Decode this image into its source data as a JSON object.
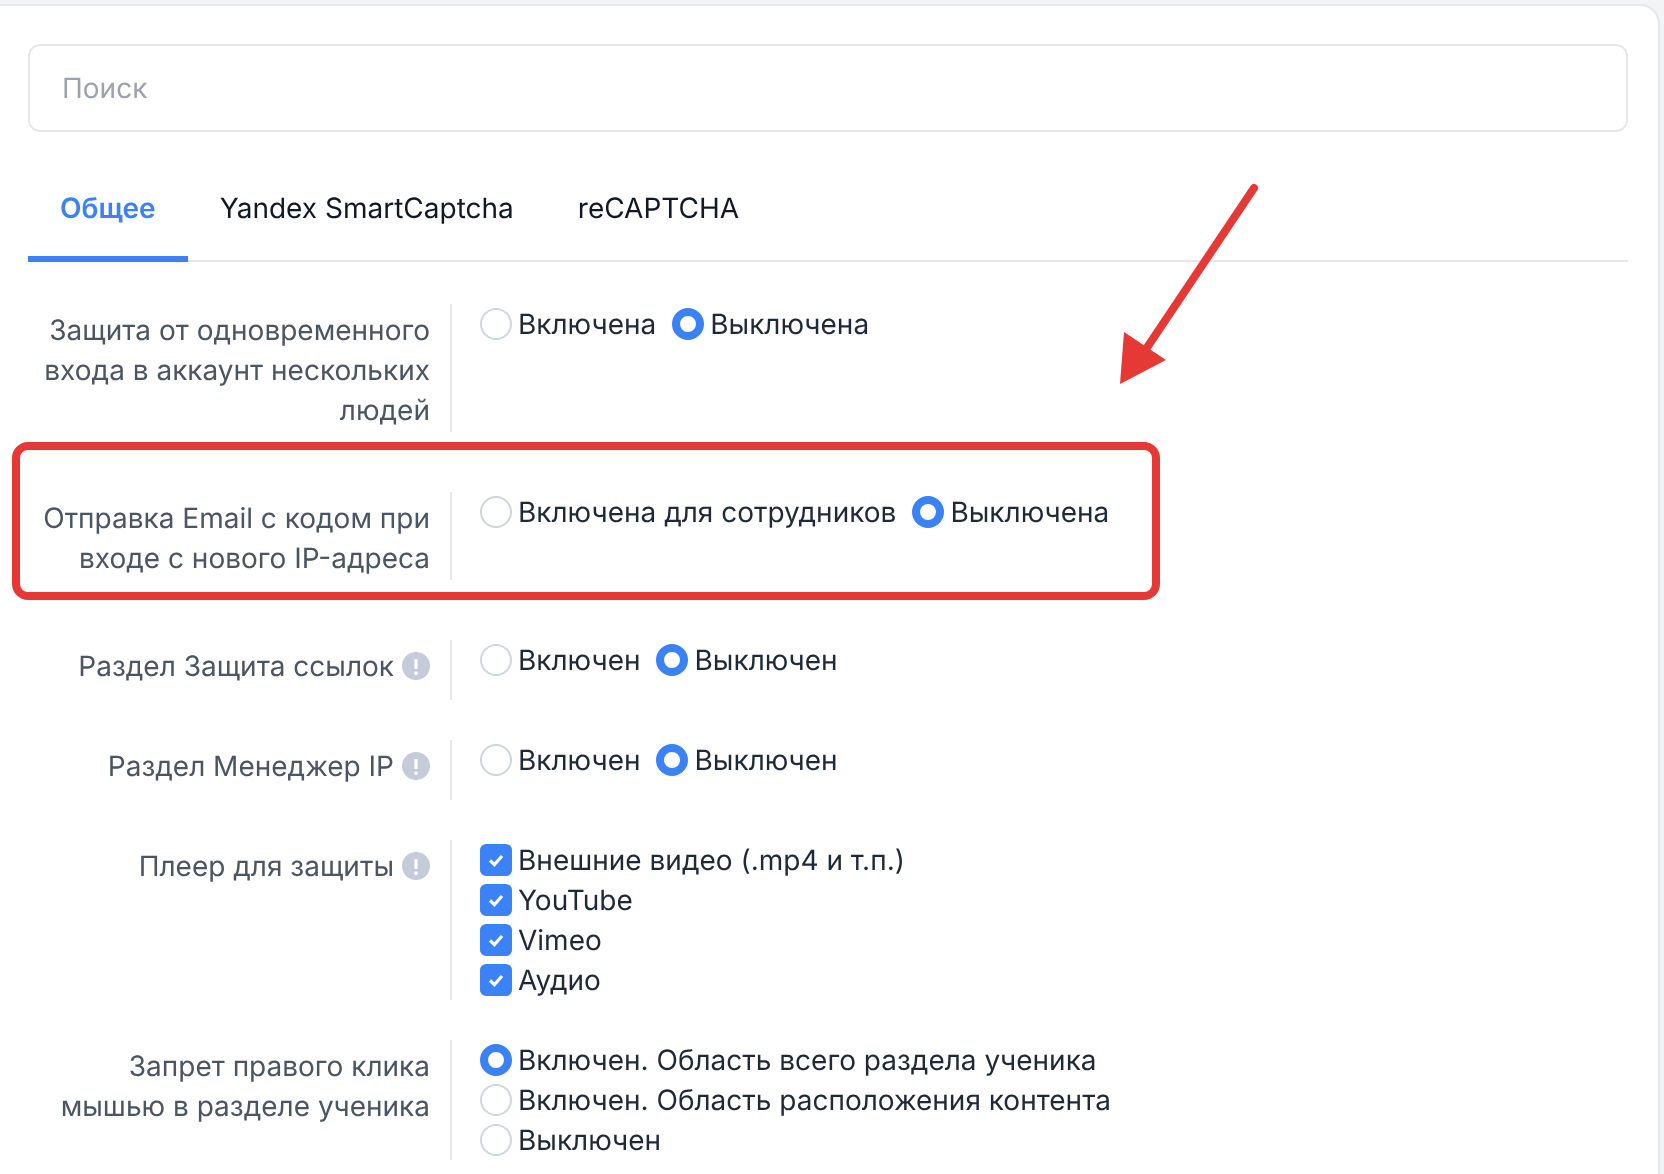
{
  "search": {
    "placeholder": "Поиск"
  },
  "tabs": [
    {
      "label": "Общее",
      "selected": true
    },
    {
      "label": "Yandex SmartCaptcha",
      "selected": false
    },
    {
      "label": "reCAPTCHA",
      "selected": false
    }
  ],
  "settings": [
    {
      "label": "Защита от одновременного входа в аккаунт нескольких людей",
      "info": false,
      "highlighted": false,
      "kind": "radio",
      "options": [
        {
          "label": "Включена",
          "selected": false
        },
        {
          "label": "Выключена",
          "selected": true
        }
      ]
    },
    {
      "label": "Отправка Email с кодом при входе с нового IP-адреса",
      "info": false,
      "highlighted": true,
      "kind": "radio",
      "options": [
        {
          "label": "Включена для сотрудников",
          "selected": false
        },
        {
          "label": "Выключена",
          "selected": true
        }
      ]
    },
    {
      "label": "Раздел Защита ссылок",
      "info": true,
      "highlighted": false,
      "kind": "radio",
      "options": [
        {
          "label": "Включен",
          "selected": false
        },
        {
          "label": "Выключен",
          "selected": true
        }
      ]
    },
    {
      "label": "Раздел Менеджер IP",
      "info": true,
      "highlighted": false,
      "kind": "radio",
      "options": [
        {
          "label": "Включен",
          "selected": false
        },
        {
          "label": "Выключен",
          "selected": true
        }
      ]
    },
    {
      "label": "Плеер для защиты",
      "info": true,
      "highlighted": false,
      "kind": "checkbox",
      "options": [
        {
          "label": "Внешние видео (.mp4 и т.п.)",
          "checked": true
        },
        {
          "label": "YouTube",
          "checked": true
        },
        {
          "label": "Vimeo",
          "checked": true
        },
        {
          "label": "Аудио",
          "checked": true
        }
      ]
    },
    {
      "label": "Запрет правого клика мышью в разделе ученика",
      "info": false,
      "highlighted": false,
      "kind": "radio-list",
      "options": [
        {
          "label": "Включен. Область всего раздела ученика",
          "selected": true
        },
        {
          "label": "Включен. Область расположения контента",
          "selected": false
        },
        {
          "label": "Выключен",
          "selected": false
        }
      ]
    }
  ]
}
